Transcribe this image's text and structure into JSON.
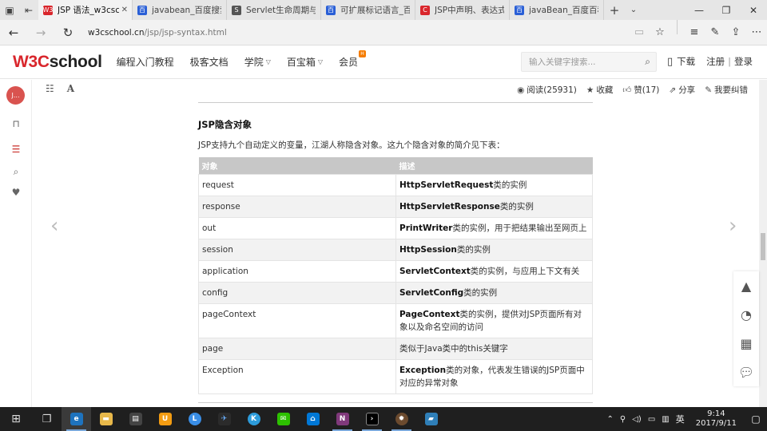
{
  "browser": {
    "tabs": [
      {
        "title": "JSP 语法_w3csch",
        "favicon": "W3",
        "color": "#d9262c",
        "active": true
      },
      {
        "title": "javabean_百度搜索",
        "favicon": "百",
        "color": "#2a5fd6",
        "active": false
      },
      {
        "title": "Servlet生命周期与工",
        "favicon": "S",
        "color": "#555555",
        "active": false
      },
      {
        "title": "可扩展标记语言_百度",
        "favicon": "百",
        "color": "#2a5fd6",
        "active": false
      },
      {
        "title": "JSP中声明、表达式和",
        "favicon": "C",
        "color": "#d9262c",
        "active": false
      },
      {
        "title": "javaBean_百度百科",
        "favicon": "百",
        "color": "#2a5fd6",
        "active": false
      }
    ],
    "url_host": "w3cschool.cn",
    "url_path": "/jsp/jsp-syntax.html"
  },
  "site": {
    "logo_w3c": "W3C",
    "logo_school": "school",
    "nav": [
      {
        "label": "编程入门教程",
        "caret": false
      },
      {
        "label": "极客文档",
        "caret": false
      },
      {
        "label": "学院",
        "caret": true
      },
      {
        "label": "百宝箱",
        "caret": true
      },
      {
        "label": "会员",
        "caret": false,
        "badge": "hot"
      }
    ],
    "search_placeholder": "输入关键字搜索...",
    "download": "下载",
    "register": "注册",
    "separator": "|",
    "login": "登录"
  },
  "article_toolbar": {
    "reads": "阅读(25931)",
    "favorite": "收藏",
    "likes": "赞(17)",
    "share": "分享",
    "report": "我要纠错"
  },
  "content": {
    "heading": "JSP隐含对象",
    "intro": "JSP支持九个自动定义的变量，江湖人称隐含对象。这九个隐含对象的简介见下表：",
    "table": {
      "headers": [
        "对象",
        "描述"
      ],
      "rows": [
        {
          "obj": "request",
          "bold": "HttpServletRequest",
          "rest": "类的实例"
        },
        {
          "obj": "response",
          "bold": "HttpServletResponse",
          "rest": "类的实例"
        },
        {
          "obj": "out",
          "bold": "PrintWriter",
          "rest": "类的实例，用于把结果输出至网页上"
        },
        {
          "obj": "session",
          "bold": "HttpSession",
          "rest": "类的实例"
        },
        {
          "obj": "application",
          "bold": "ServletContext",
          "rest": "类的实例，与应用上下文有关"
        },
        {
          "obj": "config",
          "bold": "ServletConfig",
          "rest": "类的实例"
        },
        {
          "obj": "pageContext",
          "bold": "PageContext",
          "rest": "类的实例，提供对JSP页面所有对象以及命名空间的访问"
        },
        {
          "obj": "page",
          "bold": "",
          "rest": "类似于Java类中的this关键字"
        },
        {
          "obj": "Exception",
          "bold": "Exception",
          "rest": "类的对象，代表发生错误的JSP页面中对应的异常对象"
        }
      ]
    }
  },
  "taskbar": {
    "ime": "英",
    "time": "9:14",
    "date": "2017/9/11"
  }
}
